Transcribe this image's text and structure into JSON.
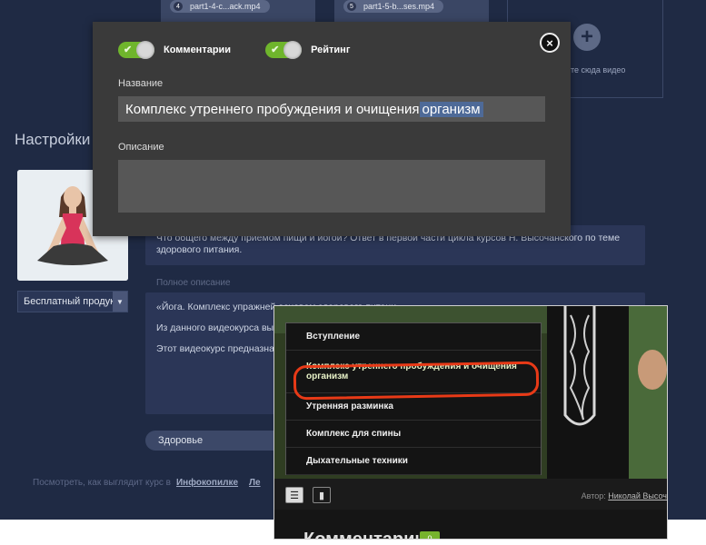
{
  "thumbs": [
    {
      "num": "4",
      "label": "part1-4-c...ack.mp4"
    },
    {
      "num": "5",
      "label": "part1-5-b...ses.mp4"
    }
  ],
  "add_video": {
    "text": "ите сюда видео"
  },
  "settings": {
    "title": "Настройки",
    "product_select": "Бесплатный продук",
    "short_description": "Что общего между приемом пищи и йогой? Ответ в первой части цикла курсов Н. Высочанского по теме здорового питания.",
    "full_description_label": "Полное описание",
    "full_description": [
      "«Йога. Комплекс упражней основам здорового питани",
      "Из данного видеокурса вы комплект утреннего пробу комплекс упражнений для",
      "Этот видеокурс предназна необходима."
    ],
    "category": "Здоровье",
    "bottom_prefix": "Посмотреть, как выглядит курс в",
    "bottom_link": "Инфокопилке",
    "bottom_link2": "Ле"
  },
  "modal": {
    "toggle_comments": "Комментарии",
    "toggle_rating": "Рейтинг",
    "close": "×",
    "name_label": "Название",
    "name_value": "Комплекс утреннего пробуждения и очищения",
    "name_selected": "организм",
    "description_label": "Описание",
    "description_value": ""
  },
  "player": {
    "chapters": [
      {
        "label": "Вступление"
      },
      {
        "label": "Комплекс утреннего пробуждения и очищения организм"
      },
      {
        "label": "Утренняя разминка"
      },
      {
        "label": "Комплекс для спины"
      },
      {
        "label": "Дыхательные техники"
      }
    ],
    "author_prefix": "Автор:",
    "author_name": "Николай Высоч",
    "comments_title": "Комментарии",
    "comments_count": "0"
  },
  "colors": {
    "page_bg": "#1f2a44",
    "modal_bg": "#3a3a3a",
    "toggle_on": "#6fb52c",
    "highlight": "#e83a17",
    "selection": "#4e6a98"
  }
}
